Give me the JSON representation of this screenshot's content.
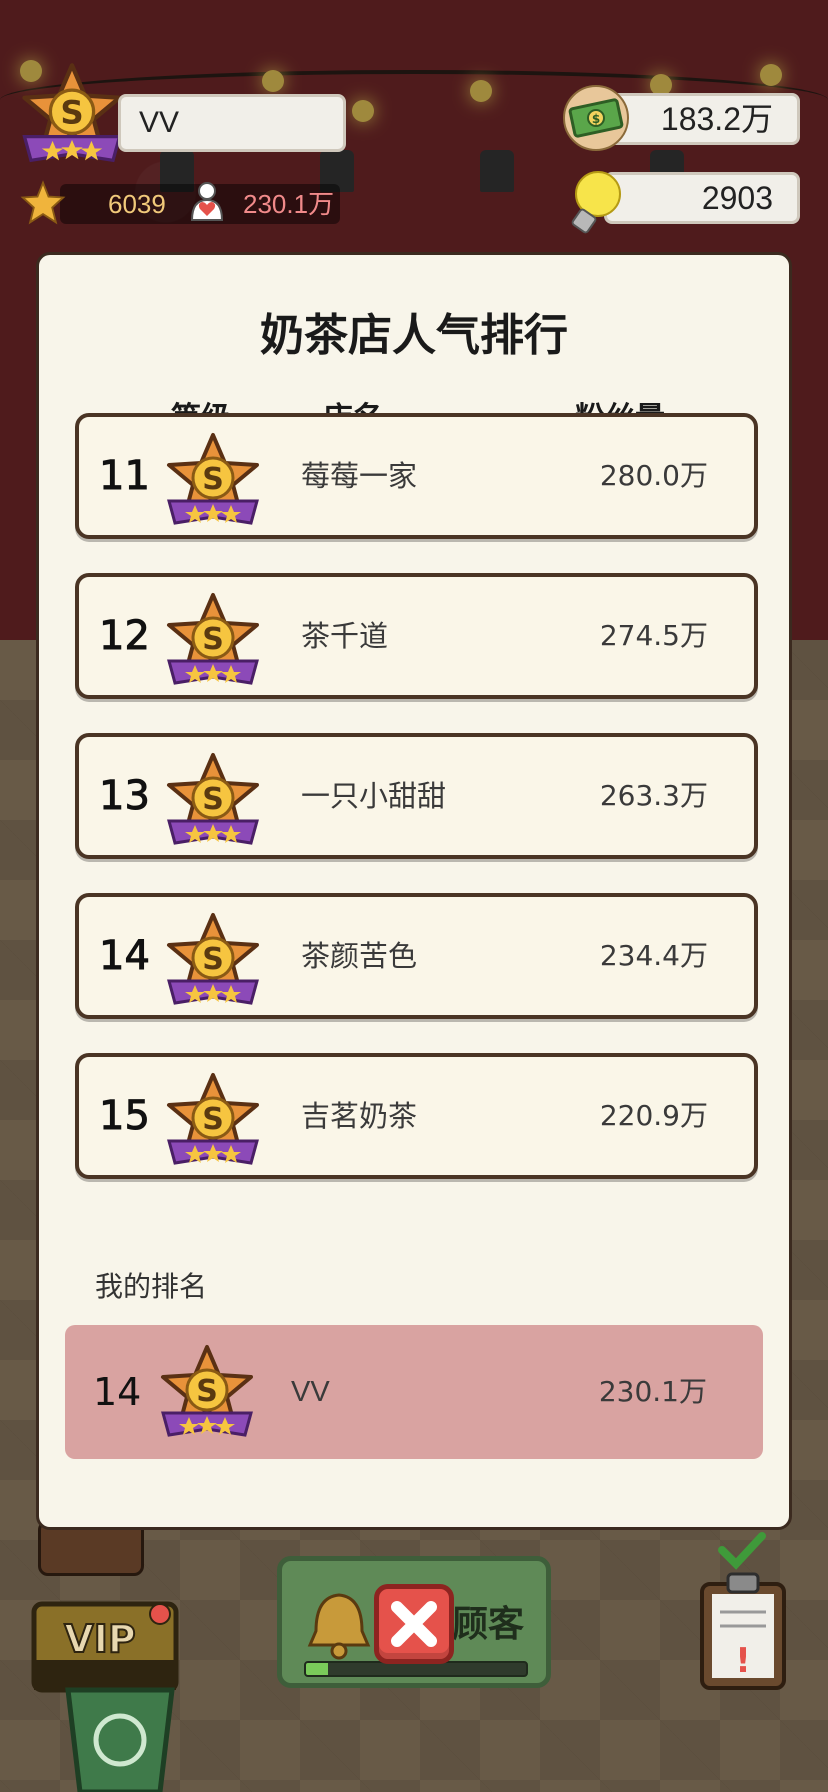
{
  "hud": {
    "player_name": "VV",
    "badge_letter": "S",
    "level": "6039",
    "fans": "230.1万",
    "money": "183.2万",
    "ideas": "2903"
  },
  "panel": {
    "title": "奶茶店人气排行",
    "headers": {
      "level": "等级",
      "name": "店名",
      "fans": "粉丝量"
    },
    "rows": [
      {
        "rank": "11",
        "name": "莓莓一家",
        "fans": "280.0万"
      },
      {
        "rank": "12",
        "name": "茶千道",
        "fans": "274.5万"
      },
      {
        "rank": "13",
        "name": "一只小甜甜",
        "fans": "263.3万"
      },
      {
        "rank": "14",
        "name": "茶颜苦色",
        "fans": "234.4万"
      },
      {
        "rank": "15",
        "name": "吉茗奶茶",
        "fans": "220.9万"
      }
    ],
    "my_label": "我的排名",
    "my_row": {
      "rank": "14",
      "name": "VV",
      "fans": "230.1万"
    }
  },
  "bottom": {
    "vip_label": "VIP",
    "customer_label": "顾客",
    "customer_progress": 0.1
  },
  "colors": {
    "panel_bg": "#f8f5ea",
    "my_row_bg": "#d9a3a1",
    "badge_orange": "#e8923a",
    "badge_purple": "#8c4ab8",
    "fans_red": "#f08a8a"
  }
}
